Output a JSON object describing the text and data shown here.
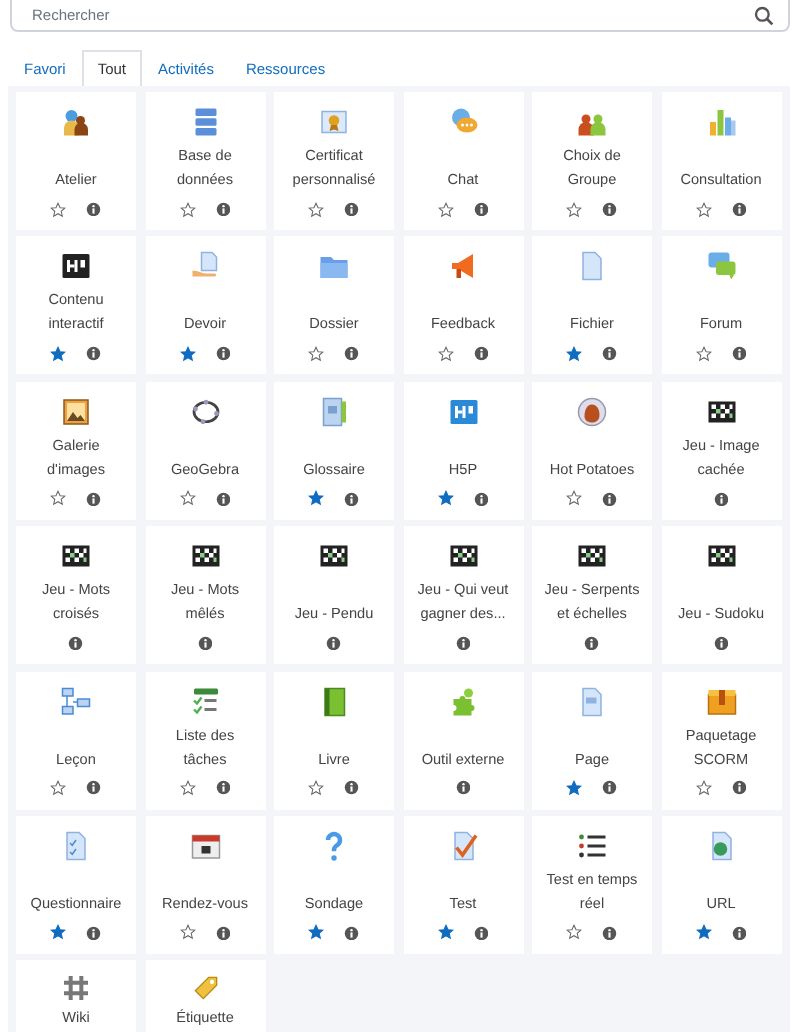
{
  "search": {
    "placeholder": "Rechercher"
  },
  "tabs": [
    {
      "label": "Favori",
      "selected": false
    },
    {
      "label": "Tout",
      "selected": true
    },
    {
      "label": "Activités",
      "selected": false
    },
    {
      "label": "Ressources",
      "selected": false
    }
  ],
  "modules": [
    {
      "label": "Atelier",
      "kind": "favoritable",
      "starred": false
    },
    {
      "label": "Base de données",
      "kind": "favoritable",
      "starred": false
    },
    {
      "label": "Certificat personnalisé",
      "kind": "favoritable",
      "starred": false
    },
    {
      "label": "Chat",
      "kind": "favoritable",
      "starred": false
    },
    {
      "label": "Choix de Groupe",
      "kind": "favoritable",
      "starred": false
    },
    {
      "label": "Consultation",
      "kind": "favoritable",
      "starred": false
    },
    {
      "label": "Contenu interactif",
      "kind": "favoritable",
      "starred": true
    },
    {
      "label": "Devoir",
      "kind": "favoritable",
      "starred": true
    },
    {
      "label": "Dossier",
      "kind": "favoritable",
      "starred": false
    },
    {
      "label": "Feedback",
      "kind": "favoritable",
      "starred": false
    },
    {
      "label": "Fichier",
      "kind": "favoritable",
      "starred": true
    },
    {
      "label": "Forum",
      "kind": "favoritable",
      "starred": false
    },
    {
      "label": "Galerie d'images",
      "kind": "favoritable",
      "starred": false
    },
    {
      "label": "GeoGebra",
      "kind": "favoritable",
      "starred": false
    },
    {
      "label": "Glossaire",
      "kind": "favoritable",
      "starred": true
    },
    {
      "label": "H5P",
      "kind": "favoritable",
      "starred": true
    },
    {
      "label": "Hot Potatoes",
      "kind": "favoritable",
      "starred": false
    },
    {
      "label": "Jeu - Image cachée",
      "kind": "info_only"
    },
    {
      "label": "Jeu - Mots croisés",
      "kind": "info_only"
    },
    {
      "label": "Jeu - Mots mêlés",
      "kind": "info_only"
    },
    {
      "label": "Jeu - Pendu",
      "kind": "info_only"
    },
    {
      "label": "Jeu - Qui veut gagner des...",
      "kind": "info_only"
    },
    {
      "label": "Jeu - Serpents et échelles",
      "kind": "info_only"
    },
    {
      "label": "Jeu - Sudoku",
      "kind": "info_only"
    },
    {
      "label": "Leçon",
      "kind": "favoritable",
      "starred": false
    },
    {
      "label": "Liste des tâches",
      "kind": "favoritable",
      "starred": false
    },
    {
      "label": "Livre",
      "kind": "favoritable",
      "starred": false
    },
    {
      "label": "Outil externe",
      "kind": "info_only"
    },
    {
      "label": "Page",
      "kind": "favoritable",
      "starred": true
    },
    {
      "label": "Paquetage SCORM",
      "kind": "favoritable",
      "starred": false
    },
    {
      "label": "Questionnaire",
      "kind": "favoritable",
      "starred": true
    },
    {
      "label": "Rendez-vous",
      "kind": "favoritable",
      "starred": false
    },
    {
      "label": "Sondage",
      "kind": "favoritable",
      "starred": true
    },
    {
      "label": "Test",
      "kind": "favoritable",
      "starred": true
    },
    {
      "label": "Test en temps réel",
      "kind": "favoritable",
      "starred": false
    },
    {
      "label": "URL",
      "kind": "favoritable",
      "starred": true
    },
    {
      "label": "Wiki",
      "kind": "cut_off"
    },
    {
      "label": "Étiquette",
      "kind": "cut_off"
    }
  ]
}
